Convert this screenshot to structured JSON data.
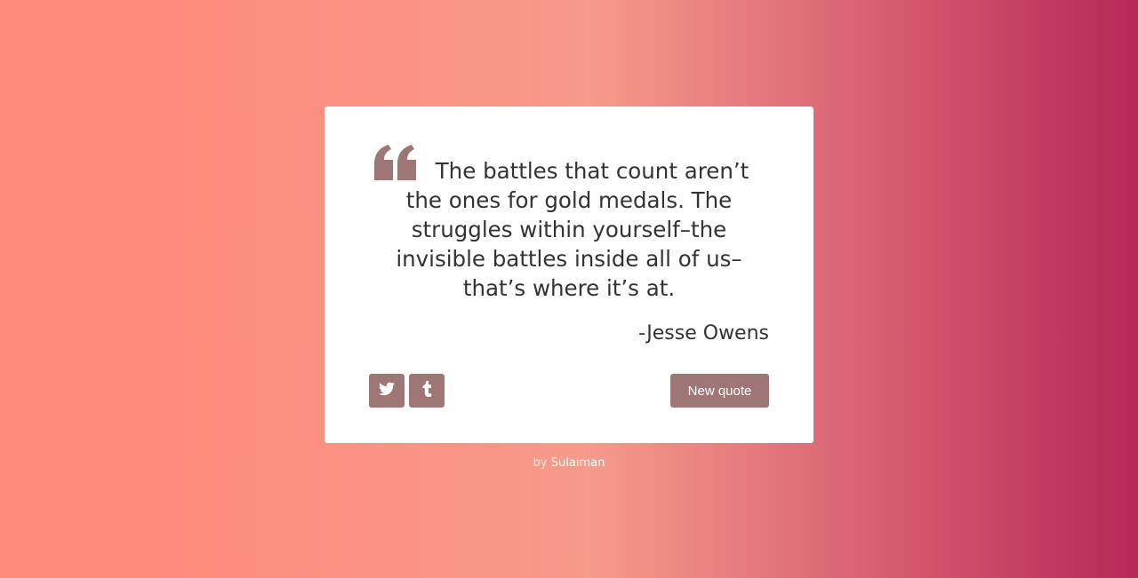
{
  "quote": {
    "text": "The battles that count aren’t the ones for gold medals. The struggles within yourself–the invisible battles inside all of us–that’s where it’s at.",
    "author": "-Jesse Owens",
    "icon": "quote-left-icon"
  },
  "actions": {
    "twitter_icon": "twitter-icon",
    "tumblr_icon": "tumblr-icon",
    "new_quote_label": "New quote"
  },
  "footer": {
    "by_label": "by",
    "author_name": "Sulaiman"
  },
  "colors": {
    "accent": "#9e7676",
    "gradient_start": "#ff8a7a",
    "gradient_end": "#b5295a"
  }
}
